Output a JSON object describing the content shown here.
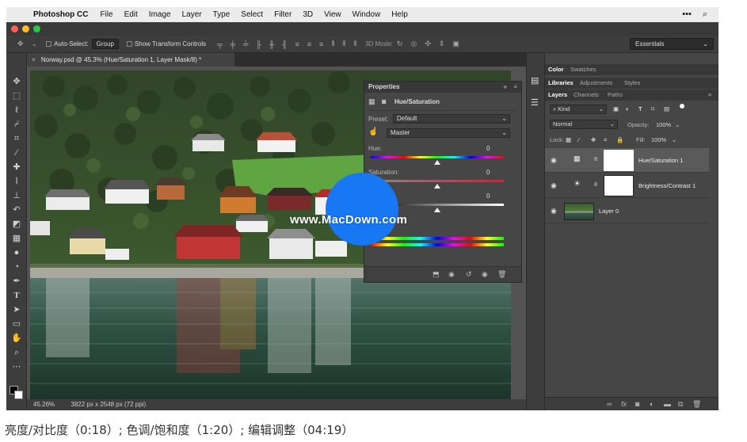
{
  "menubar": {
    "apple_icon": "apple-logo-icon",
    "app_name": "Photoshop CC",
    "items": [
      "File",
      "Edit",
      "Image",
      "Layer",
      "Type",
      "Select",
      "Filter",
      "3D",
      "View",
      "Window",
      "Help"
    ],
    "right_icons": [
      "more-icon",
      "search-icon"
    ]
  },
  "traffic_lights": {
    "close": "#ff5f57",
    "minimize": "#febc2e",
    "zoom": "#28c840"
  },
  "options_bar": {
    "auto_select_label": "Auto-Select:",
    "auto_select_value": "Group",
    "transform_label": "Show Transform Controls",
    "mode_label": "3D Mode:",
    "workspace": "Essentials"
  },
  "document": {
    "tab_title": "Norway.psd @ 45.3% (Hue/Saturation 1, Layer Mask/8) *",
    "zoom": "45.26%",
    "dimensions": "3822 px x 2548 px (72 ppi)"
  },
  "properties": {
    "title": "Properties",
    "adjustment_name": "Hue/Saturation",
    "preset_label": "Preset:",
    "preset_value": "Default",
    "channel_value": "Master",
    "hue_label": "Hue:",
    "hue_value": "0",
    "saturation_label": "Saturation:",
    "saturation_value": "0",
    "lightness_value": "0",
    "hue_slider_fraction": 0.5,
    "saturation_slider_fraction": 0.5,
    "lightness_slider_fraction": 0.5
  },
  "dock": {
    "top_tabs": [
      "Color",
      "Swatches"
    ],
    "mid_tabs": [
      "Libraries",
      "Adjustments",
      "Styles"
    ],
    "layer_tabs": [
      "Layers",
      "Channels",
      "Paths"
    ],
    "kind_label": "Kind",
    "blend_mode": "Normal",
    "opacity_label": "Opacity:",
    "opacity_value": "100%",
    "lock_label": "Lock:",
    "fill_label": "Fill:",
    "fill_value": "100%",
    "layers": [
      {
        "name": "Hue/Saturation 1"
      },
      {
        "name": "Brightness/Contrast 1"
      },
      {
        "name": "Layer 0"
      }
    ]
  },
  "watermark": {
    "text": "www.MacDown.com"
  },
  "caption": "亮度/对比度（0:18）; 色调/饱和度（1:20）; 编辑调整（04:19）"
}
